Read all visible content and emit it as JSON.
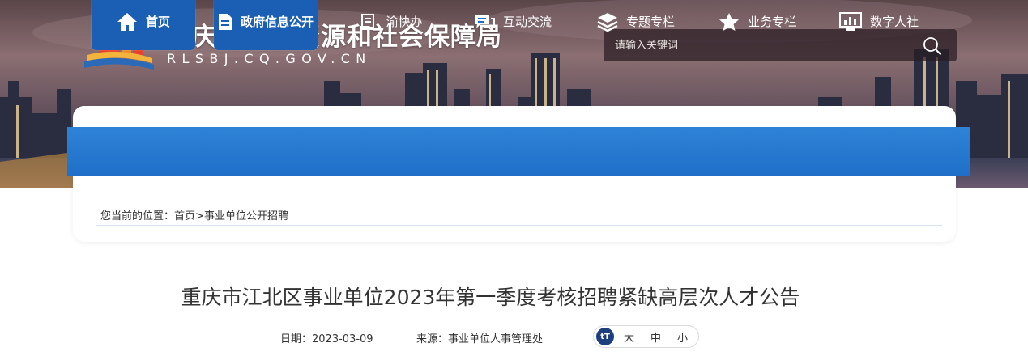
{
  "header": {
    "site_title": "重庆市人力资源和社会保障局",
    "site_domain": "RLSBJ.CQ.GOV.CN",
    "search_placeholder": "请输入关键词"
  },
  "nav": {
    "items": [
      {
        "label": "首页",
        "icon": "home-icon",
        "active": true
      },
      {
        "label": "政府信息公开",
        "icon": "document-icon",
        "active": true
      },
      {
        "label": "渝快办",
        "icon": "book-icon",
        "active": false
      },
      {
        "label": "互动交流",
        "icon": "chat-icon",
        "active": false
      },
      {
        "label": "专题专栏",
        "icon": "layers-icon",
        "active": false
      },
      {
        "label": "业务专栏",
        "icon": "star-icon",
        "active": false
      },
      {
        "label": "数字人社",
        "icon": "monitor-chart-icon",
        "active": false
      }
    ]
  },
  "breadcrumb": {
    "prefix": "您当前的位置：",
    "home": "首页",
    "separator": ">",
    "current": "事业单位公开招聘"
  },
  "article": {
    "title": "重庆市江北区事业单位2023年第一季度考核招聘紧缺高层次人才公告",
    "date_label": "日期：",
    "date": "2023-03-09",
    "source_label": "来源：",
    "source": "事业单位人事管理处",
    "font_size_icon_text": "tT",
    "font_large": "大",
    "font_medium": "中",
    "font_small": "小"
  },
  "colors": {
    "nav_blue": "#2f83d7",
    "nav_active": "#1b5fb4",
    "text": "#333333"
  }
}
